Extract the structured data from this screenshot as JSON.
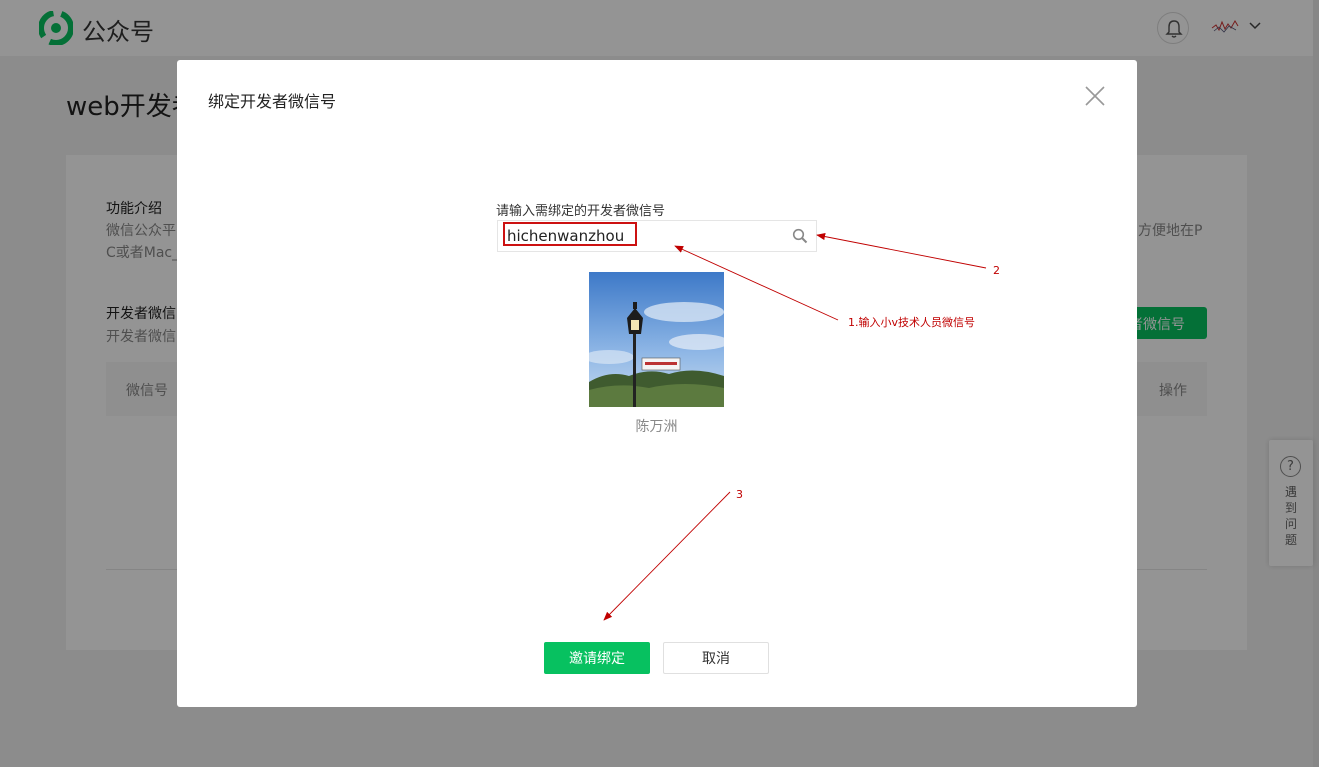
{
  "header": {
    "brand": "公众号",
    "brand_color": "#07c160",
    "icons": [
      "wechat-mp-logo-icon",
      "bell-icon",
      "chevron-down-icon"
    ]
  },
  "background_page": {
    "title": "web开发者",
    "intro_heading": "功能介绍",
    "intro_text_left_1": "微信公众平",
    "intro_text_left_2": "C或者Mac_",
    "intro_text_right": "方便地在P",
    "bind_heading": "开发者微信",
    "bind_text": "开发者微信",
    "bind_button_partial": "者微信号",
    "table_col_wechat": "微信号",
    "table_col_actions": "操作"
  },
  "help_widget": {
    "label": "遇到问题",
    "icon": "question-circle-icon"
  },
  "dialog": {
    "title": "绑定开发者微信号",
    "field_label": "请输入需绑定的开发者微信号",
    "search_value": "hichenwanzhou",
    "result_name": "陈万洲",
    "confirm_label": "邀请绑定",
    "cancel_label": "取消"
  },
  "annotations": {
    "step1": "1.输入小v技术人员微信号",
    "step2": "2",
    "step3": "3",
    "color": "#c00000"
  }
}
